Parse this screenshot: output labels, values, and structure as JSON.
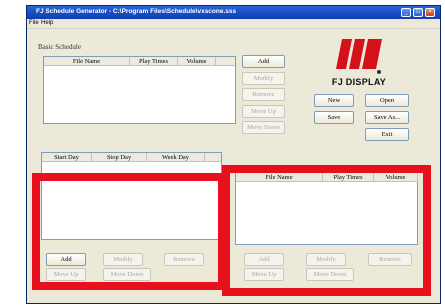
{
  "window": {
    "title": "FJ Schedule Generator - C:\\Program Files\\Schedule\\vxscone.sss",
    "controls": {
      "minimize": "_",
      "maximize": "□",
      "close": "×"
    }
  },
  "menu": {
    "file": "File",
    "help": "Help"
  },
  "basic_schedule": {
    "label": "Basic Schedule",
    "columns": [
      "File Name",
      "Play Times",
      "Volume"
    ],
    "buttons": {
      "add": "Add",
      "modify": "Modify",
      "remove": "Remove",
      "move_up": "Move Up",
      "move_down": "Move Down"
    }
  },
  "logo": {
    "text": "FJ DISPLAY",
    "brand_color": "#d4111b"
  },
  "file_buttons": {
    "new": "New",
    "open": "Open",
    "save": "Save",
    "save_as": "Save As...",
    "exit": "Exit"
  },
  "advance_schedule": {
    "columns": [
      "Start Day",
      "Stop Day",
      "Week Day"
    ],
    "buttons": {
      "add": "Add",
      "modify": "Modify",
      "remove": "Remove",
      "move_up": "Move Up",
      "move_down": "Move Down"
    }
  },
  "advance_detail": {
    "columns": [
      "File Name",
      "Play Times",
      "Volume"
    ],
    "buttons": {
      "add": "Add",
      "modify": "Modify",
      "remove": "Remove",
      "move_up": "Move Up",
      "move_down": "Move Down"
    }
  },
  "highlight_color": "#e8101c"
}
